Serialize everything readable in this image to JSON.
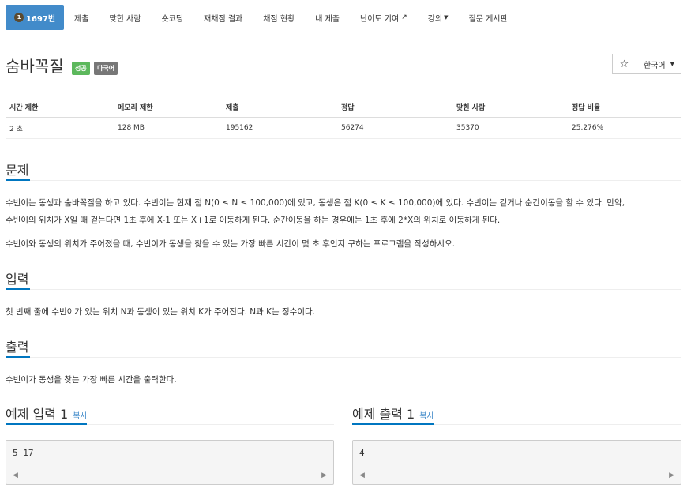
{
  "nav": {
    "items": [
      {
        "label": "1697번",
        "active": true
      },
      {
        "label": "제출"
      },
      {
        "label": "맞힌 사람"
      },
      {
        "label": "숏코딩"
      },
      {
        "label": "재채점 결과"
      },
      {
        "label": "채점 현황"
      },
      {
        "label": "내 제출"
      },
      {
        "label": "난이도 기여"
      },
      {
        "label": "강의"
      },
      {
        "label": "질문 게시판"
      }
    ],
    "tier_badge": "1"
  },
  "problem": {
    "title": "숨바꼭질",
    "status_label": "성공",
    "multi_label": "다국어",
    "star_icon": "☆",
    "language_button": "한국어"
  },
  "info_table": {
    "headers": [
      "시간 제한",
      "메모리 제한",
      "제출",
      "정답",
      "맞힌 사람",
      "정답 비율"
    ],
    "values": [
      "2 초",
      "128 MB",
      "195162",
      "56274",
      "35370",
      "25.276%"
    ]
  },
  "sections": {
    "problem": {
      "heading": "문제",
      "p1_line1": "수빈이는 동생과 숨바꼭질을 하고 있다. 수빈이는 현재 점 N(0 ≤ N ≤ 100,000)에 있고, 동생은 점 K(0 ≤ K ≤ 100,000)에 있다. 수빈이는 걷거나 순간이동을 할 수 있다. 만약,",
      "p1_line2": "수빈이의 위치가 X일 때 걷는다면 1초 후에 X-1 또는 X+1로 이동하게 된다. 순간이동을 하는 경우에는 1초 후에 2*X의 위치로 이동하게 된다.",
      "p2": "수빈이와 동생의 위치가 주어졌을 때, 수빈이가 동생을 찾을 수 있는 가장 빠른 시간이 몇 초 후인지 구하는 프로그램을 작성하시오."
    },
    "input": {
      "heading": "입력",
      "text": "첫 번째 줄에 수빈이가 있는 위치 N과 동생이 있는 위치 K가 주어진다. N과 K는 정수이다."
    },
    "output": {
      "heading": "출력",
      "text": "수빈이가 동생을 찾는 가장 빠른 시간을 출력한다."
    },
    "sample_input": {
      "heading": "예제 입력 1",
      "copy": "복사",
      "value": "5 17"
    },
    "sample_output": {
      "heading": "예제 출력 1",
      "copy": "복사",
      "value": "4"
    }
  }
}
